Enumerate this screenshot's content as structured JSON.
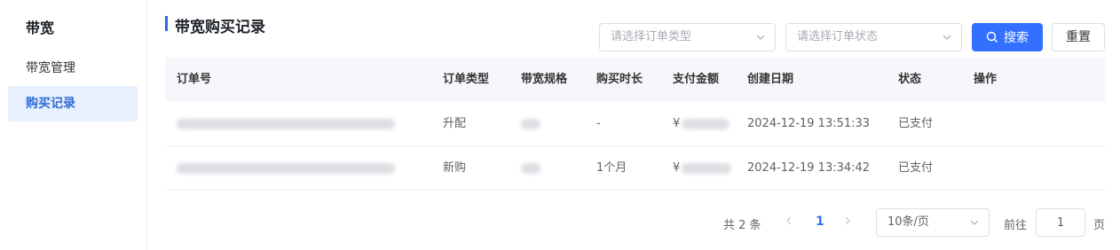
{
  "sidebar": {
    "title": "带宽",
    "items": [
      {
        "label": "带宽管理",
        "active": false
      },
      {
        "label": "购买记录",
        "active": true
      }
    ]
  },
  "page": {
    "title": "带宽购买记录"
  },
  "filters": {
    "order_type_placeholder": "请选择订单类型",
    "order_status_placeholder": "请选择订单状态",
    "search_label": "搜索",
    "reset_label": "重置"
  },
  "table": {
    "headers": {
      "order_no": "订单号",
      "order_type": "订单类型",
      "spec": "带宽规格",
      "duration": "购买时长",
      "amount": "支付金额",
      "created": "创建日期",
      "status": "状态",
      "ops": "操作"
    },
    "rows": [
      {
        "order_type": "升配",
        "duration": "-",
        "currency": "¥",
        "created": "2024-12-19 13:51:33",
        "status": "已支付"
      },
      {
        "order_type": "新购",
        "duration": "1个月",
        "currency": "¥",
        "created": "2024-12-19 13:34:42",
        "status": "已支付"
      }
    ]
  },
  "pagination": {
    "total_label": "共 2 条",
    "current_page": "1",
    "page_size": "10条/页",
    "goto_label": "前往",
    "goto_value": "1",
    "goto_unit": "页"
  },
  "colors": {
    "accent": "#3370ff",
    "title_bar": "#2e6bd8",
    "active_bg": "#e8f0fe"
  }
}
